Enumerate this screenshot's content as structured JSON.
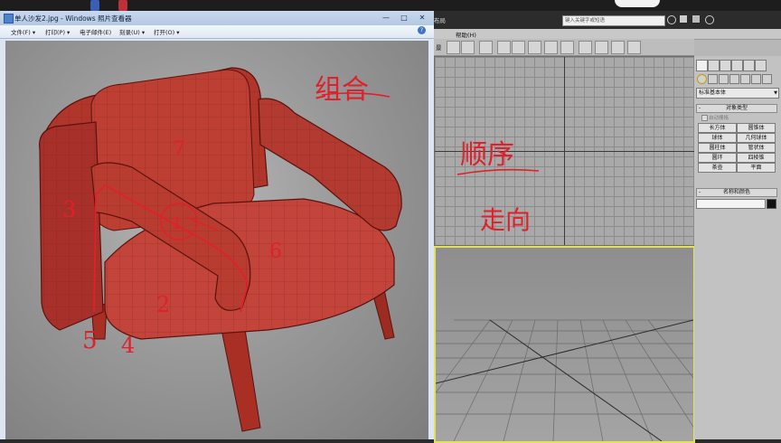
{
  "viewer": {
    "title": "单人沙发2.jpg - Windows 照片查看器",
    "menu": [
      "文件(F) ▾",
      "打印(P) ▾",
      "电子邮件(E)",
      "刻录(U) ▾",
      "打开(O) ▾"
    ],
    "help": "?",
    "window_buttons": [
      "—",
      "□",
      "✕"
    ]
  },
  "photo": {
    "annotations": {
      "combine": "组合",
      "sequence": "顺序",
      "direction": "走向",
      "num1": "1",
      "num2": "2",
      "num3": "3",
      "num4": "4",
      "num5": "5",
      "num6": "6",
      "num7": "7"
    }
  },
  "max": {
    "search_placeholder": "键入关键字或短语",
    "menu_fragment": "帮助(H)",
    "toolbar_fragment": "景",
    "title_fragment": "布局",
    "command_panel": {
      "dropdown": "标准基本体",
      "rollout_object_type": "对象类型",
      "autogrid": "自动栅格",
      "buttons": [
        "长方体",
        "圆锥体",
        "球体",
        "几何球体",
        "圆柱体",
        "管状体",
        "圆环",
        "四棱锥",
        "茶壶",
        "平面"
      ],
      "rollout_name_color": "名称和颜色",
      "pm": "-"
    }
  },
  "colors": {
    "annotation": "#e0202a",
    "sofa": "#b8342a",
    "active_viewport_border": "#e3e05a"
  }
}
